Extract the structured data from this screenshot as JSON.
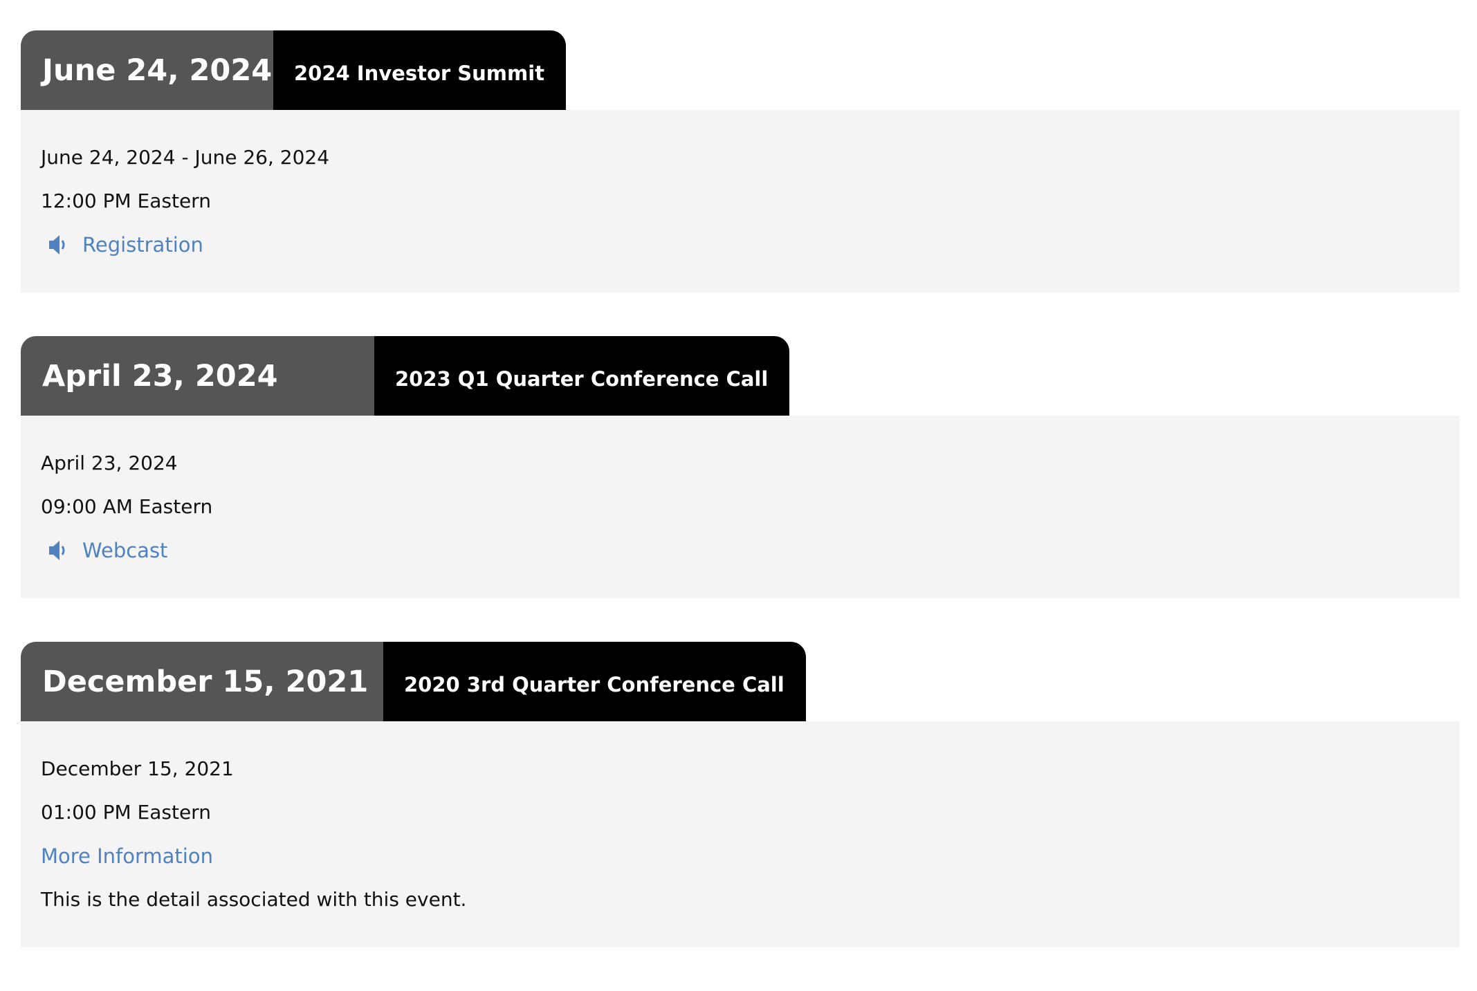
{
  "events": [
    {
      "header_date": "June 24, 2024",
      "title": "2024 Investor Summit",
      "date_range": "June 24, 2024 - June 26, 2024",
      "time": "12:00 PM Eastern",
      "link_label": "Registration",
      "link_icon": "speaker-icon"
    },
    {
      "header_date": "April 23, 2024",
      "title": "2023 Q1 Quarter Conference Call",
      "date_range": "April 23, 2024",
      "time": "09:00 AM Eastern",
      "link_label": "Webcast",
      "link_icon": "speaker-icon"
    },
    {
      "header_date": "December 15, 2021",
      "title": "2020 3rd Quarter Conference Call",
      "date_range": "December 15, 2021",
      "time": "01:00 PM Eastern",
      "link_label": "More Information",
      "detail": "This is the detail associated with this event."
    }
  ],
  "colors": {
    "date_bg": "#555555",
    "title_bg": "#000000",
    "body_bg": "#f4f4f4",
    "link": "#4f82bf"
  }
}
